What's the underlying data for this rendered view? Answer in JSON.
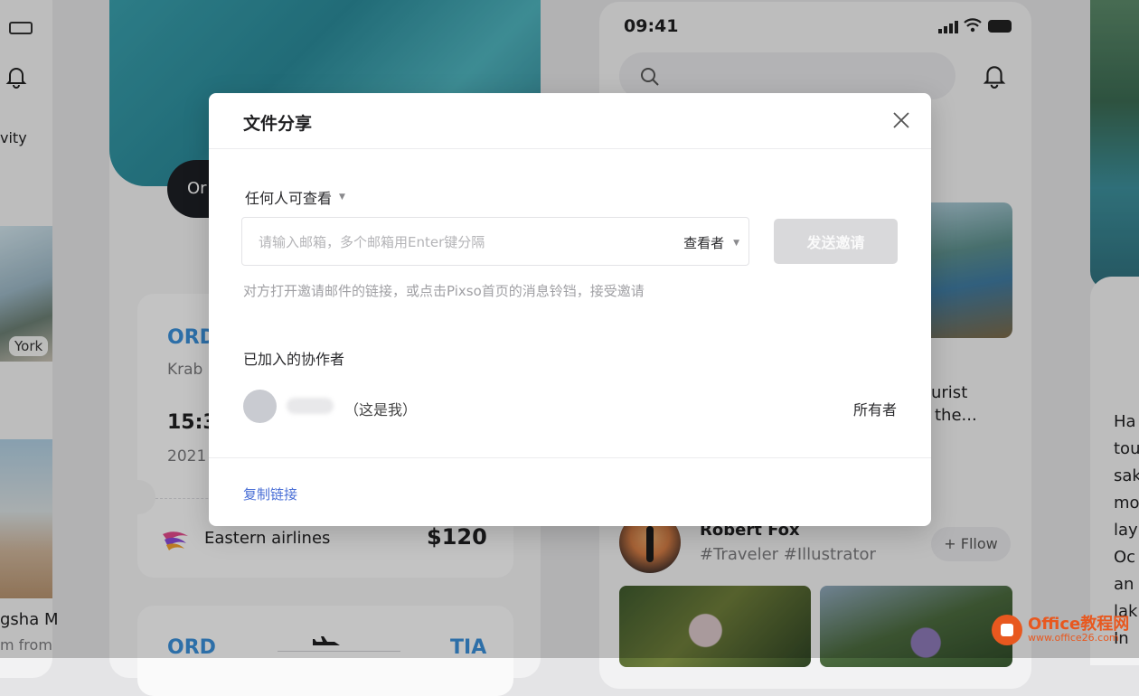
{
  "background": {
    "left_panel": {
      "activity_text": "vity",
      "york_tag": "York",
      "bottom_title": "gsha M",
      "bottom_sub": "m from"
    },
    "ticket_panel": {
      "pill_text": "Or",
      "ticket1": {
        "origin": "ORD",
        "origin_city": "Krab",
        "time": "15:3",
        "date": "2021",
        "airline": "Eastern airlines",
        "price": "$120"
      },
      "ticket2": {
        "origin": "ORD",
        "destination": "TIA"
      }
    },
    "phone_panel": {
      "time": "09:41",
      "tourist_line1": "urist",
      "tourist_line2": "the...",
      "user_name": "Robert Fox",
      "user_tags": "#Traveler #Illustrator",
      "follow_label": "+ Fllow"
    },
    "right_panel": {
      "text_lines": [
        "Ha",
        "tou",
        "sak",
        "mo",
        "lay",
        "Oc",
        "an",
        "lak",
        "In"
      ]
    }
  },
  "modal": {
    "title": "文件分享",
    "permission": "任何人可查看",
    "email_placeholder": "请输入邮箱，多个邮箱用Enter键分隔",
    "role": "查看者",
    "send_button": "发送邀请",
    "hint": "对方打开邀请邮件的链接，或点击Pixso首页的消息铃铛，接受邀请",
    "collaborators_title": "已加入的协作者",
    "collaborators": [
      {
        "me_label": "（这是我）",
        "role": "所有者"
      }
    ],
    "copy_link": "复制链接"
  },
  "watermark": {
    "title": "Office教程网",
    "url": "www.office26.com"
  },
  "colors": {
    "link": "#4a6fd6",
    "accent_blue": "#3a8fd8",
    "watermark": "#e8581f"
  }
}
